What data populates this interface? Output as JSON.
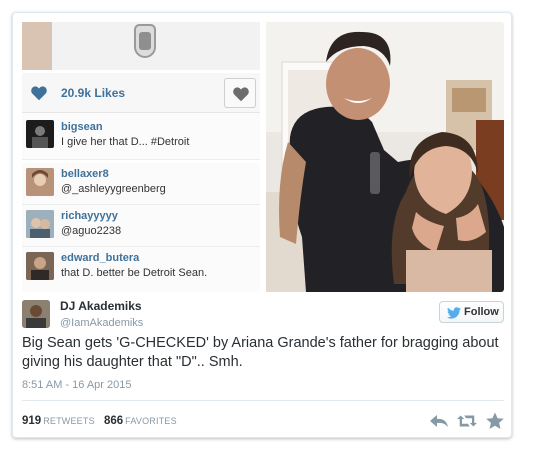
{
  "instagram": {
    "likes": "20.9k Likes",
    "comments": [
      {
        "user": "bigsean",
        "text": "I give her that D... #Detroit"
      },
      {
        "user": "bellaxer8",
        "text": "@_ashleyygreenberg"
      },
      {
        "user": "richayyyyy",
        "text": "@aguo2238"
      },
      {
        "user": "edward_butera",
        "text": "that D. better be Detroit Sean."
      }
    ]
  },
  "tweet": {
    "name": "DJ Akademiks",
    "handle": "@IamAkademiks",
    "follow_label": "Follow",
    "text": "Big Sean gets 'G-CHECKED' by Ariana Grande's father for bragging about giving his daughter that \"D\".. Smh.",
    "time": "8:51 AM - 16 Apr 2015",
    "retweets_count": "919",
    "retweets_label": "RETWEETS",
    "favorites_count": "866",
    "favorites_label": "FAVORITES"
  },
  "colors": {
    "instagram_blue": "#3f729b",
    "twitter_blue": "#55acee",
    "muted": "#8899a6"
  },
  "icons": [
    "heart-icon",
    "twitter-bird-icon",
    "reply-icon",
    "retweet-icon",
    "favorite-star-icon"
  ]
}
